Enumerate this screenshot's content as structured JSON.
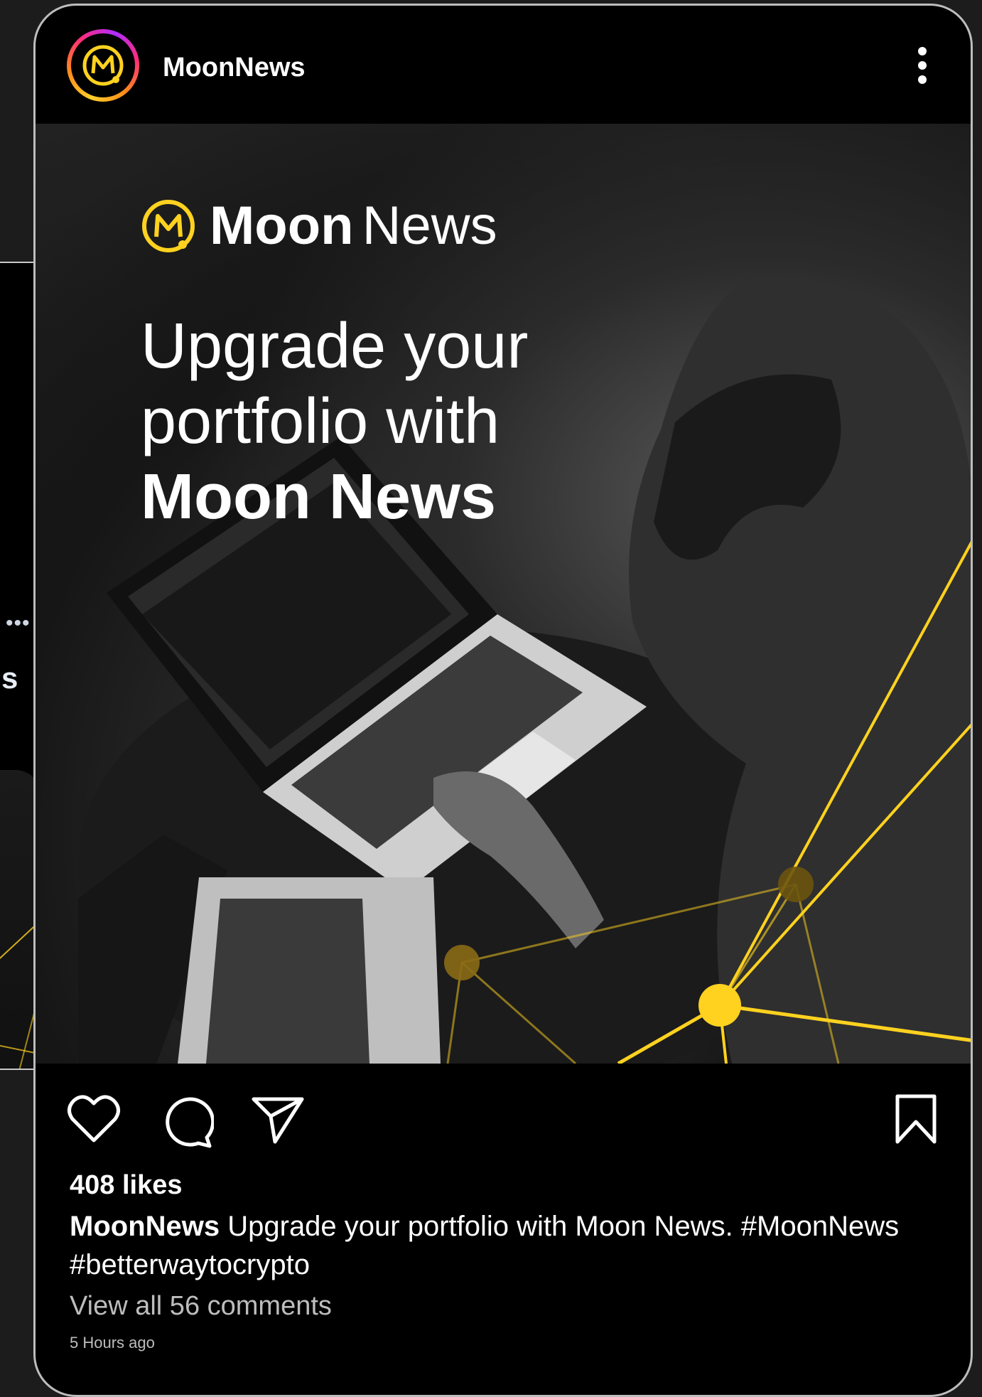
{
  "background_card": {
    "name_fragment": "s",
    "menu_dots": "•••"
  },
  "post": {
    "account_name": "MoonNews",
    "image": {
      "brand_bold": "Moon",
      "brand_light": "News",
      "headline_line1": "Upgrade your",
      "headline_line2": "portfolio with",
      "headline_line3": "Moon News"
    },
    "likes": "408 likes",
    "caption_user": "MoonNews",
    "caption_text": " Upgrade your portfolio with Moon News. #MoonNews #betterwaytocrypto",
    "comments_link": "View all 56 comments",
    "timestamp": "5 Hours ago"
  },
  "colors": {
    "accent_yellow": "#ffd21f",
    "background": "#1c1c1c",
    "card": "#000000"
  },
  "icons": [
    "menu-dots-icon",
    "share-upload-icon",
    "kebab-menu-icon",
    "heart-icon",
    "comment-icon",
    "send-icon",
    "bookmark-icon",
    "moon-logo-icon"
  ]
}
